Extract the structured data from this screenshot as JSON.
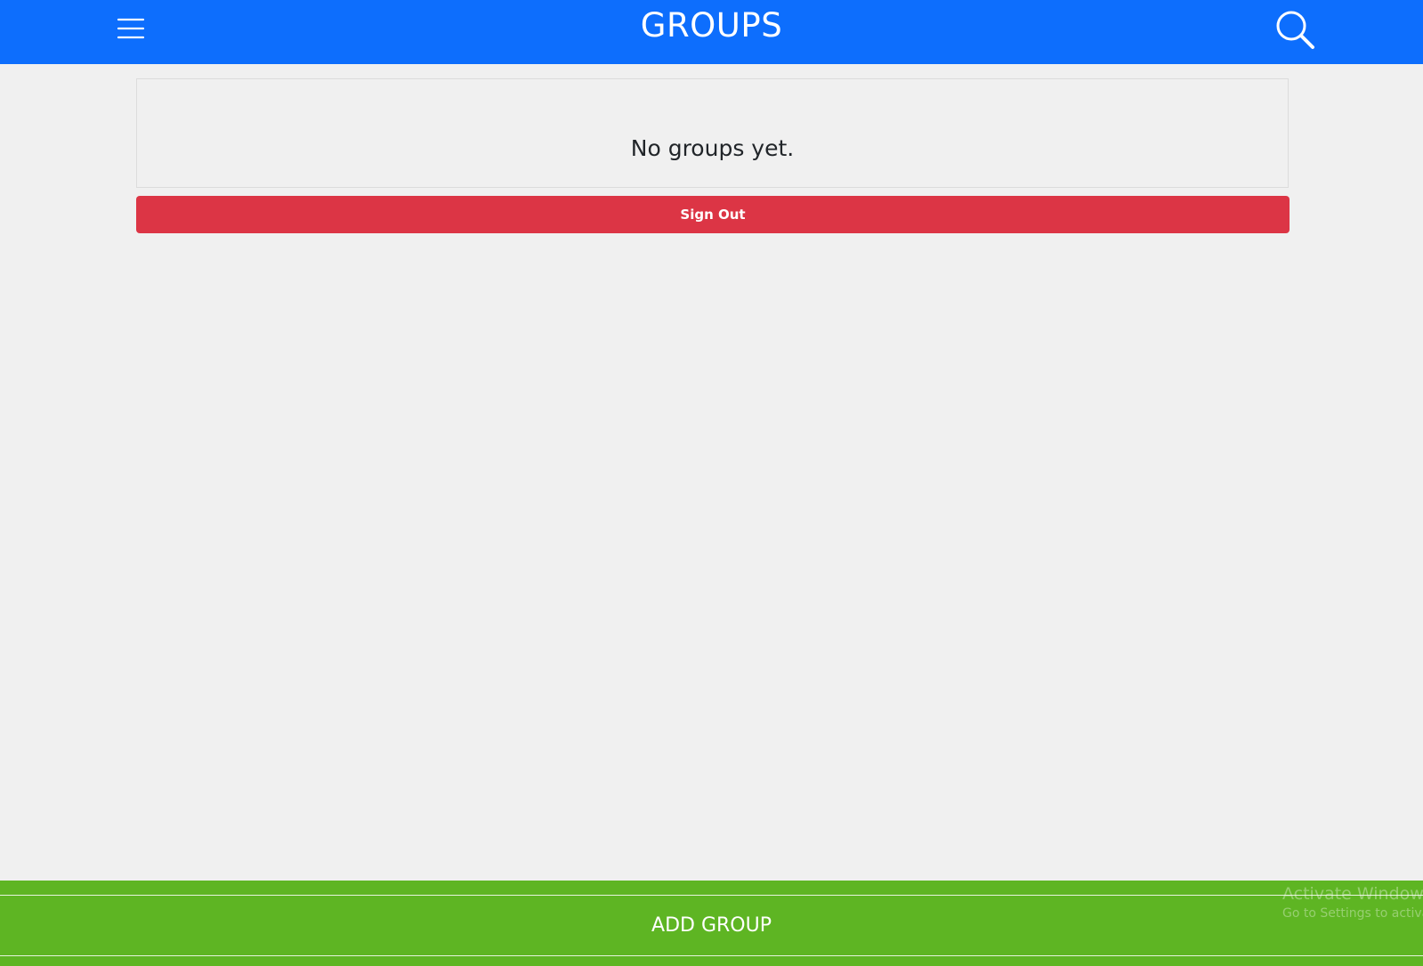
{
  "header": {
    "title": "GROUPS",
    "menu_icon": "hamburger-menu-icon",
    "search_icon": "search-icon",
    "background_color": "#0d6efd"
  },
  "main": {
    "empty_message": "No groups yet.",
    "signout_label": "Sign Out",
    "signout_color": "#dc3545"
  },
  "footer": {
    "add_group_label": "ADD GROUP",
    "background_color": "#5eb523"
  },
  "watermark": {
    "title": "Activate Windows",
    "subtitle": "Go to Settings to activate Windows."
  }
}
